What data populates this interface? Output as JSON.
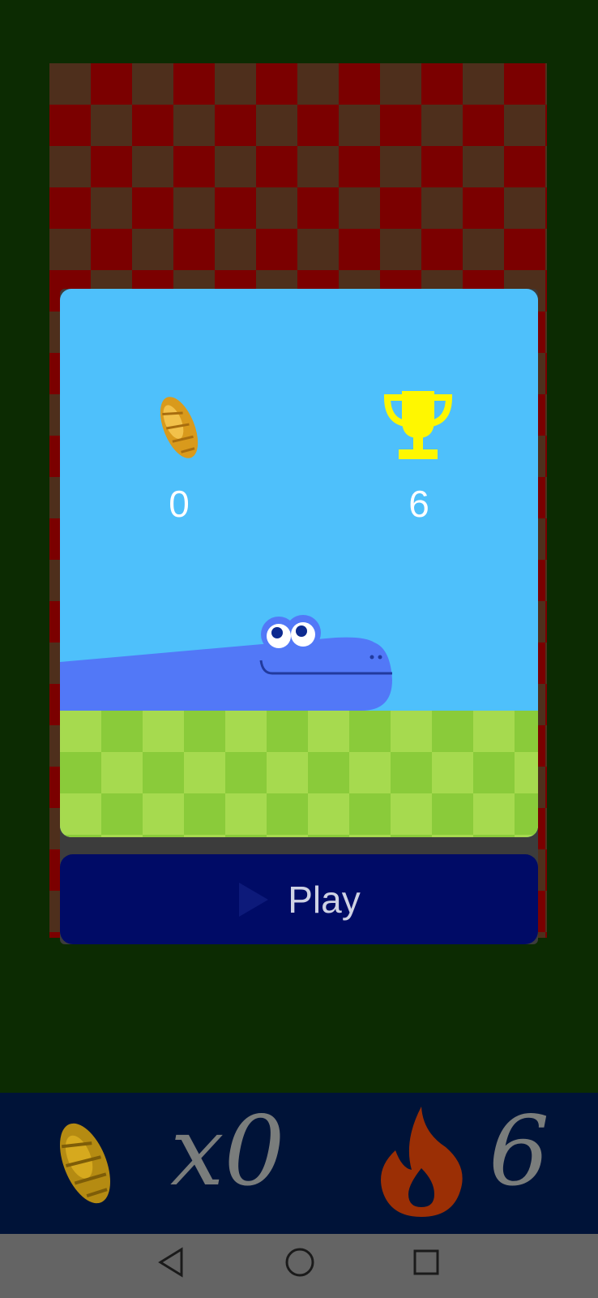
{
  "score": {
    "current": "0",
    "best": "6"
  },
  "play_button": {
    "label": "Play"
  },
  "bottom_bar": {
    "multiplier": "x0",
    "streak": "6"
  },
  "icons": {
    "food": "golden-seed-icon",
    "trophy": "trophy-icon",
    "play": "play-triangle-icon",
    "fire": "flame-icon",
    "nav_back": "back-triangle-icon",
    "nav_home": "home-circle-icon",
    "nav_recents": "recents-square-icon"
  },
  "colors": {
    "board_dark": "#4e2f1c",
    "board_red": "#7b0000",
    "card_sky": "#4ec0fb",
    "grass_light": "#a6da4f",
    "grass_dark": "#8acb3a",
    "snake": "#5278f7",
    "trophy": "#fff700",
    "play_bg": "#000b66",
    "flame": "#9b2f05"
  }
}
